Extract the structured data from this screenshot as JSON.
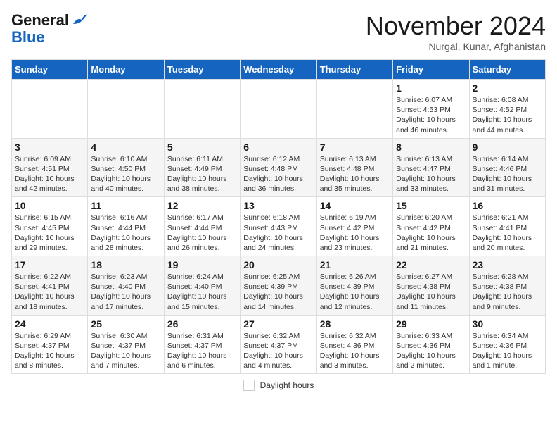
{
  "header": {
    "logo_line1": "General",
    "logo_line2": "Blue",
    "month_title": "November 2024",
    "subtitle": "Nurgal, Kunar, Afghanistan"
  },
  "weekdays": [
    "Sunday",
    "Monday",
    "Tuesday",
    "Wednesday",
    "Thursday",
    "Friday",
    "Saturday"
  ],
  "weeks": [
    [
      {
        "day": "",
        "info": ""
      },
      {
        "day": "",
        "info": ""
      },
      {
        "day": "",
        "info": ""
      },
      {
        "day": "",
        "info": ""
      },
      {
        "day": "",
        "info": ""
      },
      {
        "day": "1",
        "info": "Sunrise: 6:07 AM\nSunset: 4:53 PM\nDaylight: 10 hours and 46 minutes."
      },
      {
        "day": "2",
        "info": "Sunrise: 6:08 AM\nSunset: 4:52 PM\nDaylight: 10 hours and 44 minutes."
      }
    ],
    [
      {
        "day": "3",
        "info": "Sunrise: 6:09 AM\nSunset: 4:51 PM\nDaylight: 10 hours and 42 minutes."
      },
      {
        "day": "4",
        "info": "Sunrise: 6:10 AM\nSunset: 4:50 PM\nDaylight: 10 hours and 40 minutes."
      },
      {
        "day": "5",
        "info": "Sunrise: 6:11 AM\nSunset: 4:49 PM\nDaylight: 10 hours and 38 minutes."
      },
      {
        "day": "6",
        "info": "Sunrise: 6:12 AM\nSunset: 4:48 PM\nDaylight: 10 hours and 36 minutes."
      },
      {
        "day": "7",
        "info": "Sunrise: 6:13 AM\nSunset: 4:48 PM\nDaylight: 10 hours and 35 minutes."
      },
      {
        "day": "8",
        "info": "Sunrise: 6:13 AM\nSunset: 4:47 PM\nDaylight: 10 hours and 33 minutes."
      },
      {
        "day": "9",
        "info": "Sunrise: 6:14 AM\nSunset: 4:46 PM\nDaylight: 10 hours and 31 minutes."
      }
    ],
    [
      {
        "day": "10",
        "info": "Sunrise: 6:15 AM\nSunset: 4:45 PM\nDaylight: 10 hours and 29 minutes."
      },
      {
        "day": "11",
        "info": "Sunrise: 6:16 AM\nSunset: 4:44 PM\nDaylight: 10 hours and 28 minutes."
      },
      {
        "day": "12",
        "info": "Sunrise: 6:17 AM\nSunset: 4:44 PM\nDaylight: 10 hours and 26 minutes."
      },
      {
        "day": "13",
        "info": "Sunrise: 6:18 AM\nSunset: 4:43 PM\nDaylight: 10 hours and 24 minutes."
      },
      {
        "day": "14",
        "info": "Sunrise: 6:19 AM\nSunset: 4:42 PM\nDaylight: 10 hours and 23 minutes."
      },
      {
        "day": "15",
        "info": "Sunrise: 6:20 AM\nSunset: 4:42 PM\nDaylight: 10 hours and 21 minutes."
      },
      {
        "day": "16",
        "info": "Sunrise: 6:21 AM\nSunset: 4:41 PM\nDaylight: 10 hours and 20 minutes."
      }
    ],
    [
      {
        "day": "17",
        "info": "Sunrise: 6:22 AM\nSunset: 4:41 PM\nDaylight: 10 hours and 18 minutes."
      },
      {
        "day": "18",
        "info": "Sunrise: 6:23 AM\nSunset: 4:40 PM\nDaylight: 10 hours and 17 minutes."
      },
      {
        "day": "19",
        "info": "Sunrise: 6:24 AM\nSunset: 4:40 PM\nDaylight: 10 hours and 15 minutes."
      },
      {
        "day": "20",
        "info": "Sunrise: 6:25 AM\nSunset: 4:39 PM\nDaylight: 10 hours and 14 minutes."
      },
      {
        "day": "21",
        "info": "Sunrise: 6:26 AM\nSunset: 4:39 PM\nDaylight: 10 hours and 12 minutes."
      },
      {
        "day": "22",
        "info": "Sunrise: 6:27 AM\nSunset: 4:38 PM\nDaylight: 10 hours and 11 minutes."
      },
      {
        "day": "23",
        "info": "Sunrise: 6:28 AM\nSunset: 4:38 PM\nDaylight: 10 hours and 9 minutes."
      }
    ],
    [
      {
        "day": "24",
        "info": "Sunrise: 6:29 AM\nSunset: 4:37 PM\nDaylight: 10 hours and 8 minutes."
      },
      {
        "day": "25",
        "info": "Sunrise: 6:30 AM\nSunset: 4:37 PM\nDaylight: 10 hours and 7 minutes."
      },
      {
        "day": "26",
        "info": "Sunrise: 6:31 AM\nSunset: 4:37 PM\nDaylight: 10 hours and 6 minutes."
      },
      {
        "day": "27",
        "info": "Sunrise: 6:32 AM\nSunset: 4:37 PM\nDaylight: 10 hours and 4 minutes."
      },
      {
        "day": "28",
        "info": "Sunrise: 6:32 AM\nSunset: 4:36 PM\nDaylight: 10 hours and 3 minutes."
      },
      {
        "day": "29",
        "info": "Sunrise: 6:33 AM\nSunset: 4:36 PM\nDaylight: 10 hours and 2 minutes."
      },
      {
        "day": "30",
        "info": "Sunrise: 6:34 AM\nSunset: 4:36 PM\nDaylight: 10 hours and 1 minute."
      }
    ]
  ],
  "footer": {
    "legend_label": "Daylight hours"
  }
}
